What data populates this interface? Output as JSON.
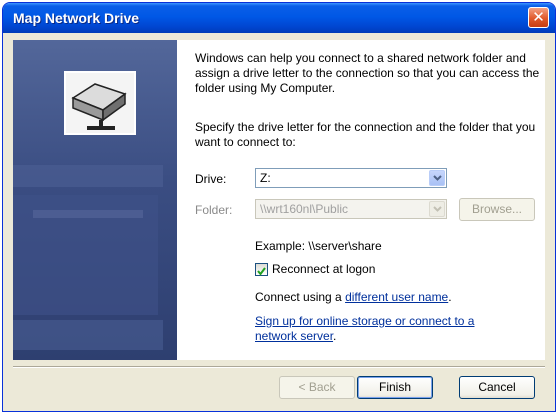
{
  "window": {
    "title": "Map Network Drive",
    "close_glyph": "✕"
  },
  "intro_text": "Windows can help you connect to a shared network folder and assign a drive letter to the connection so that you can access the folder using My Computer.",
  "specify_text": "Specify the drive letter for the connection and the folder that you want to connect to:",
  "drive": {
    "label": "Drive:",
    "value": "Z:"
  },
  "folder": {
    "label": "Folder:",
    "value": "\\\\wrt160nl\\Public",
    "browse_label": "Browse..."
  },
  "example_text": "Example: \\\\server\\share",
  "reconnect": {
    "label": "Reconnect at logon",
    "checked": true
  },
  "connect_using": {
    "prefix": "Connect using a ",
    "link": "different user name",
    "suffix": "."
  },
  "signup_link": {
    "line1": "Sign up for online storage or connect to a",
    "line2": "network server",
    "suffix": "."
  },
  "buttons": {
    "back": "< Back",
    "finish": "Finish",
    "cancel": "Cancel"
  },
  "colors": {
    "title_bar": "#0058e6",
    "side_panel": "#3a4d82",
    "link": "#00309c",
    "dialog_bg": "#ece9d8"
  },
  "icons": [
    "network-drive-icon",
    "close-icon",
    "dropdown-arrow-icon",
    "checkmark-icon"
  ]
}
